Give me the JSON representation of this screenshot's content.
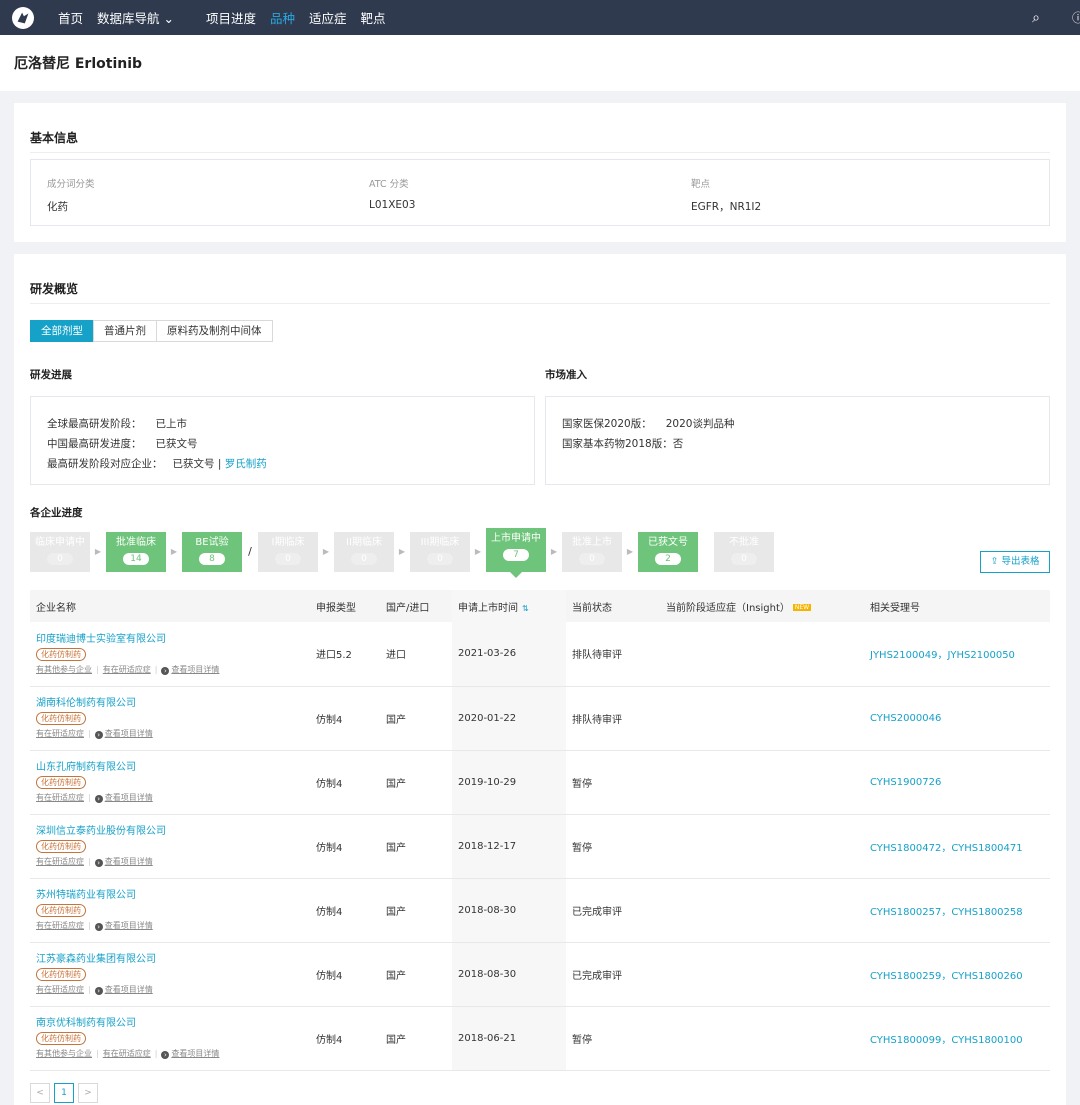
{
  "nav": {
    "items": [
      "首页",
      "数据库导航",
      "项目进度",
      "品种",
      "适应症",
      "靶点"
    ],
    "dropdown_glyph": "⌄",
    "search_icon": "search-icon",
    "help_icon": "help-icon"
  },
  "page": {
    "title": "厄洛替尼 Erlotinib"
  },
  "basic": {
    "title": "基本信息",
    "fields": [
      {
        "label": "成分词分类",
        "value": "化药"
      },
      {
        "label": "ATC 分类",
        "value": "L01XE03"
      },
      {
        "label": "靶点",
        "value": "EGFR，NR1I2"
      }
    ]
  },
  "overview": {
    "title": "研发概览",
    "tabs": [
      "全部剂型",
      "普通片剂",
      "原料药及制剂中间体"
    ],
    "progress": {
      "title": "研发进展",
      "rows": [
        {
          "k": "全球最高研发阶段：",
          "v": "已上市"
        },
        {
          "k": "中国最高研发进度：",
          "v": "已获文号"
        },
        {
          "k": "最高研发阶段对应企业：",
          "v": "已获文号 |",
          "link": "罗氏制药"
        }
      ]
    },
    "market": {
      "title": "市场准入",
      "rows": [
        {
          "k": "国家医保2020版：",
          "v": "",
          "link": "2020谈判品种"
        },
        {
          "k": "国家基本药物2018版：",
          "v": "否"
        }
      ]
    },
    "company_progress_title": "各企业进度",
    "stages": [
      {
        "name": "临床申请中",
        "count": "0",
        "color": "#e8e8e8"
      },
      {
        "name": "批准临床",
        "count": "14",
        "color": "#6dc47a"
      },
      {
        "name": "BE试验",
        "count": "8",
        "color": "#6dc47a"
      },
      {
        "name": "I期临床",
        "count": "0",
        "color": "#e8e8e8"
      },
      {
        "name": "II期临床",
        "count": "0",
        "color": "#e8e8e8"
      },
      {
        "name": "III期临床",
        "count": "0",
        "color": "#e8e8e8"
      },
      {
        "name": "上市申请中",
        "count": "7",
        "color": "#6dc47a"
      },
      {
        "name": "批准上市",
        "count": "0",
        "color": "#e8e8e8"
      },
      {
        "name": "已获文号",
        "count": "2",
        "color": "#6dc47a"
      },
      {
        "name": "不批准",
        "count": "0",
        "color": "#e8e8e8"
      }
    ],
    "stage_separator": "/",
    "export_label": "导出表格",
    "table": {
      "headers": [
        "企业名称",
        "申报类型",
        "国产/进口",
        "申请上市时间",
        "当前状态",
        "当前阶段适应症（Insight）",
        "相关受理号"
      ],
      "new_badge": "NEW",
      "rows": [
        {
          "company": "印度瑞迪博士实验室有限公司",
          "tag": "化药仿制药",
          "links": [
            "有其他参与企业",
            "有在研适应症",
            "查看项目详情"
          ],
          "type": "进口5.2",
          "origin": "进口",
          "date": "2021-03-26",
          "status": "排队待审评",
          "indication": "",
          "numbers": "JYHS2100049，JYHS2100050"
        },
        {
          "company": "湖南科伦制药有限公司",
          "tag": "化药仿制药",
          "links": [
            "有在研适应症",
            "查看项目详情"
          ],
          "type": "仿制4",
          "origin": "国产",
          "date": "2020-01-22",
          "status": "排队待审评",
          "indication": "",
          "numbers": "CYHS2000046"
        },
        {
          "company": "山东孔府制药有限公司",
          "tag": "化药仿制药",
          "links": [
            "有在研适应症",
            "查看项目详情"
          ],
          "type": "仿制4",
          "origin": "国产",
          "date": "2019-10-29",
          "status": "暂停",
          "indication": "",
          "numbers": "CYHS1900726"
        },
        {
          "company": "深圳信立泰药业股份有限公司",
          "tag": "化药仿制药",
          "links": [
            "有在研适应症",
            "查看项目详情"
          ],
          "type": "仿制4",
          "origin": "国产",
          "date": "2018-12-17",
          "status": "暂停",
          "indication": "",
          "numbers": "CYHS1800472，CYHS1800471"
        },
        {
          "company": "苏州特瑞药业有限公司",
          "tag": "化药仿制药",
          "links": [
            "有在研适应症",
            "查看项目详情"
          ],
          "type": "仿制4",
          "origin": "国产",
          "date": "2018-08-30",
          "status": "已完成审评",
          "indication": "",
          "numbers": "CYHS1800257，CYHS1800258"
        },
        {
          "company": "江苏豪森药业集团有限公司",
          "tag": "化药仿制药",
          "links": [
            "有在研适应症",
            "查看项目详情"
          ],
          "type": "仿制4",
          "origin": "国产",
          "date": "2018-08-30",
          "status": "已完成审评",
          "indication": "",
          "numbers": "CYHS1800259，CYHS1800260"
        },
        {
          "company": "南京优科制药有限公司",
          "tag": "化药仿制药",
          "links": [
            "有其他参与企业",
            "有在研适应症",
            "查看项目详情"
          ],
          "type": "仿制4",
          "origin": "国产",
          "date": "2018-06-21",
          "status": "暂停",
          "indication": "",
          "numbers": "CYHS1800099，CYHS1800100"
        }
      ]
    },
    "pagination": {
      "prev": "<",
      "current": "1",
      "next": ">"
    }
  },
  "colors": {
    "accent": "#16a1c9",
    "nav_bg": "#2f3a4e",
    "stage_active": "#6dc47a",
    "tag": "#c8733a"
  }
}
